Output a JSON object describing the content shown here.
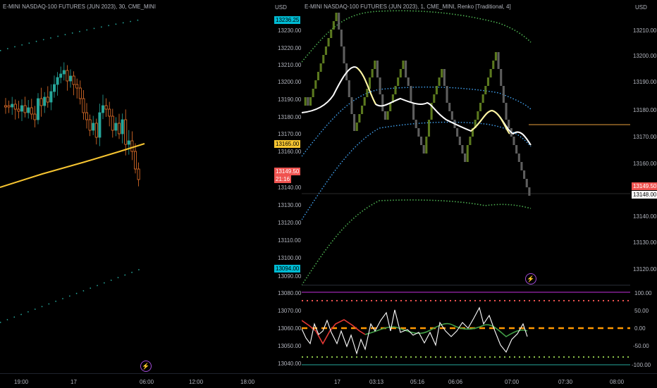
{
  "left_chart": {
    "title": "E-MINI NASDAQ-100 FUTURES (JUN 2023), 30, CME_MINI",
    "time_labels": [
      "19:00",
      "17",
      "06:00",
      "12:00",
      "18:00"
    ]
  },
  "mid_axis": {
    "currency": "USD",
    "price_labels": [
      "13230.00",
      "13220.00",
      "13210.00",
      "13200.00",
      "13190.00",
      "13180.00",
      "13170.00",
      "13160.00",
      "13140.00",
      "13130.00",
      "13120.00",
      "13110.00",
      "13100.00",
      "13090.00"
    ],
    "tag_top": "13236.25",
    "tag_ma": "13165.00",
    "tag_price": "13149.50",
    "tag_countdown": "21:16",
    "tag_bottom": "13094.00",
    "osc_labels": [
      "13080.00",
      "13070.00",
      "13060.00",
      "13050.00",
      "13040.00"
    ]
  },
  "right_chart": {
    "title": "E-MINI NASDAQ-100 FUTURES (JUN 2023), 1, CME_MINI, Renko [Traditional, 4]",
    "time_labels": [
      "17",
      "03:13",
      "05:16",
      "06:06",
      "07:00",
      "07:30",
      "08:00"
    ]
  },
  "right_axis": {
    "currency": "USD",
    "price_labels": [
      "13210.00",
      "13200.00",
      "13190.00",
      "13180.00",
      "13170.00",
      "13160.00",
      "13140.00",
      "13130.00",
      "13120.00"
    ],
    "tag_price": "13149.50",
    "tag_current": "13148.00",
    "osc_labels": [
      "100.00",
      "50.00",
      "0.00",
      "-50.00",
      "-100.00"
    ]
  },
  "colors": {
    "background": "#000000",
    "ma_yellow": "#f7c531",
    "band_green": "#4caf50",
    "band_blue": "#42a5f5",
    "tag_blue": "#00bcd4",
    "tag_red": "#f05350",
    "osc_purple": "#9c27b0",
    "osc_orange": "#ff9800"
  },
  "icons": {
    "alert": "lightning-bolt-icon"
  }
}
